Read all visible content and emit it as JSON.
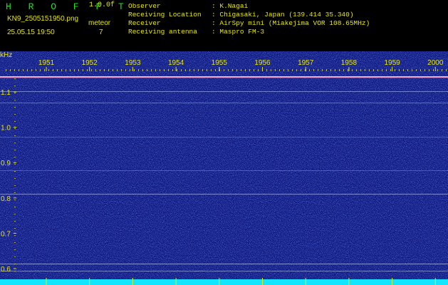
{
  "app": {
    "title": "H R O F F T",
    "version": "1.0.0f",
    "filename": "KN9_2505151950.png",
    "timestamp": "25.05.15 19:50",
    "meteor_label": "meteor",
    "meteor_count": "7"
  },
  "info": [
    {
      "key": "Observer",
      "value": ": K.Nagai"
    },
    {
      "key": "Receiving Location",
      "value": ": Chigasaki, Japan (139.414 35.340)"
    },
    {
      "key": "Receiver",
      "value": ": AirSpy mini (Miakejima VOR 108.65MHz)"
    },
    {
      "key": "Receiving antenna",
      "value": ": Maspro FM-3"
    }
  ],
  "axis": {
    "unit": "kHz",
    "y_ticks": [
      "1.1",
      "1.0",
      "0.9",
      "0.8",
      "0.7",
      "0.6"
    ],
    "x_ticks": [
      "1951",
      "1952",
      "1953",
      "1954",
      "1955",
      "1956",
      "1957",
      "1958",
      "1959",
      "2000"
    ]
  },
  "colors": {
    "background": "#000000",
    "spectrum": "#0b1478",
    "title": "#1fe21f",
    "labels": "#e8e800",
    "baseline": "#12e6ff"
  }
}
